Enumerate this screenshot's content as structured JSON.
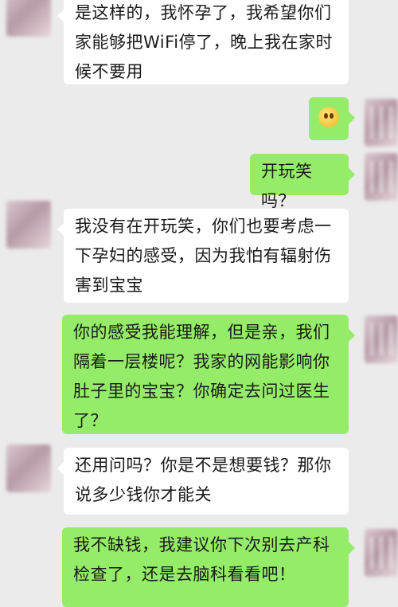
{
  "messages": [
    {
      "side": "left",
      "text": "是这样的，我怀孕了，我希望你们家能够把WiFi停了，晚上我在家时候不要用"
    },
    {
      "side": "right",
      "emoji": "surprised-face-emoji"
    },
    {
      "side": "right",
      "text": "开玩笑吗？"
    },
    {
      "side": "left",
      "text": "我没有在开玩笑，你们也要考虑一下孕妇的感受，因为我怕有辐射伤害到宝宝"
    },
    {
      "side": "right",
      "text": "你的感受我能理解，但是亲，我们隔着一层楼呢？我家的网能影响你肚子里的宝宝？你确定去问过医生了？"
    },
    {
      "side": "left",
      "text": "还用问吗？你是不是想要钱？那你说多少钱你才能关"
    },
    {
      "side": "right",
      "text": "我不缺钱，我建议你下次别去产科检查了，还是去脑科看看吧！"
    }
  ],
  "colors": {
    "background": "#ebebeb",
    "incoming": "#ffffff",
    "outgoing": "#95ec69"
  }
}
